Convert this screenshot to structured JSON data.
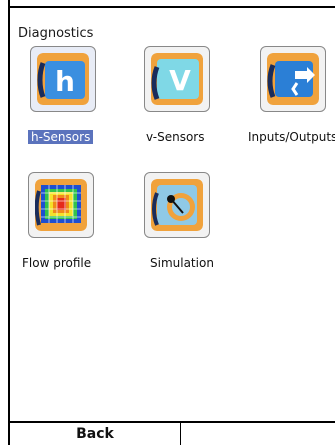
{
  "header": {
    "title": "Diagnostics"
  },
  "items": [
    {
      "label": "h-Sensors",
      "icon": "h-sensor-icon",
      "selected": true
    },
    {
      "label": "v-Sensors",
      "icon": "v-sensor-icon",
      "selected": false
    },
    {
      "label": "Inputs/Outputs",
      "icon": "inputs-outputs-icon",
      "selected": false
    },
    {
      "label": "Flow profile",
      "icon": "flow-profile-icon",
      "selected": false
    },
    {
      "label": "Simulation",
      "icon": "simulation-icon",
      "selected": false
    }
  ],
  "footer": {
    "back_label": "Back"
  },
  "colors": {
    "selection": "#5b73bd",
    "icon_orange": "#f0a23c",
    "icon_blue": "#2b7fd6"
  }
}
